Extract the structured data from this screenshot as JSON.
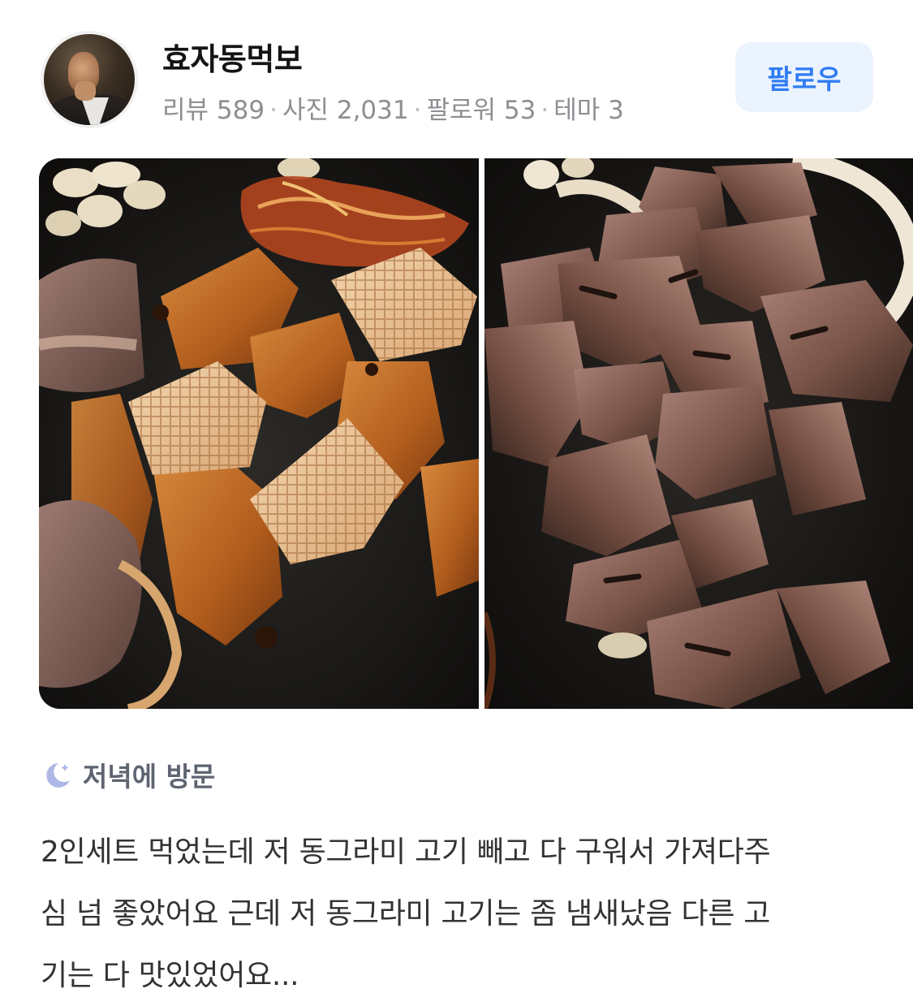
{
  "profile": {
    "name": "효자동먹보",
    "stats": [
      {
        "label": "리뷰",
        "value": "589"
      },
      {
        "label": "사진",
        "value": "2,031"
      },
      {
        "label": "팔로워",
        "value": "53"
      },
      {
        "label": "테마",
        "value": "3"
      }
    ],
    "follow_label": "팔로우"
  },
  "visit": {
    "icon": "moon-icon",
    "label": "저녁에 방문"
  },
  "review": {
    "lines": [
      "2인세트 먹었는데 저 동그라미 고기 빼고 다 구워서 가져다주",
      "심 넘 좋았어요 근데 저 동그라미 고기는 좀 냄새났음 다른 고",
      "기는 다 맛있었어요..."
    ]
  },
  "colors": {
    "accent": "#2f7cf3",
    "follow_bg": "#ebf3fe",
    "name": "#141414",
    "meta": "#8e8e93",
    "body": "#333333"
  }
}
